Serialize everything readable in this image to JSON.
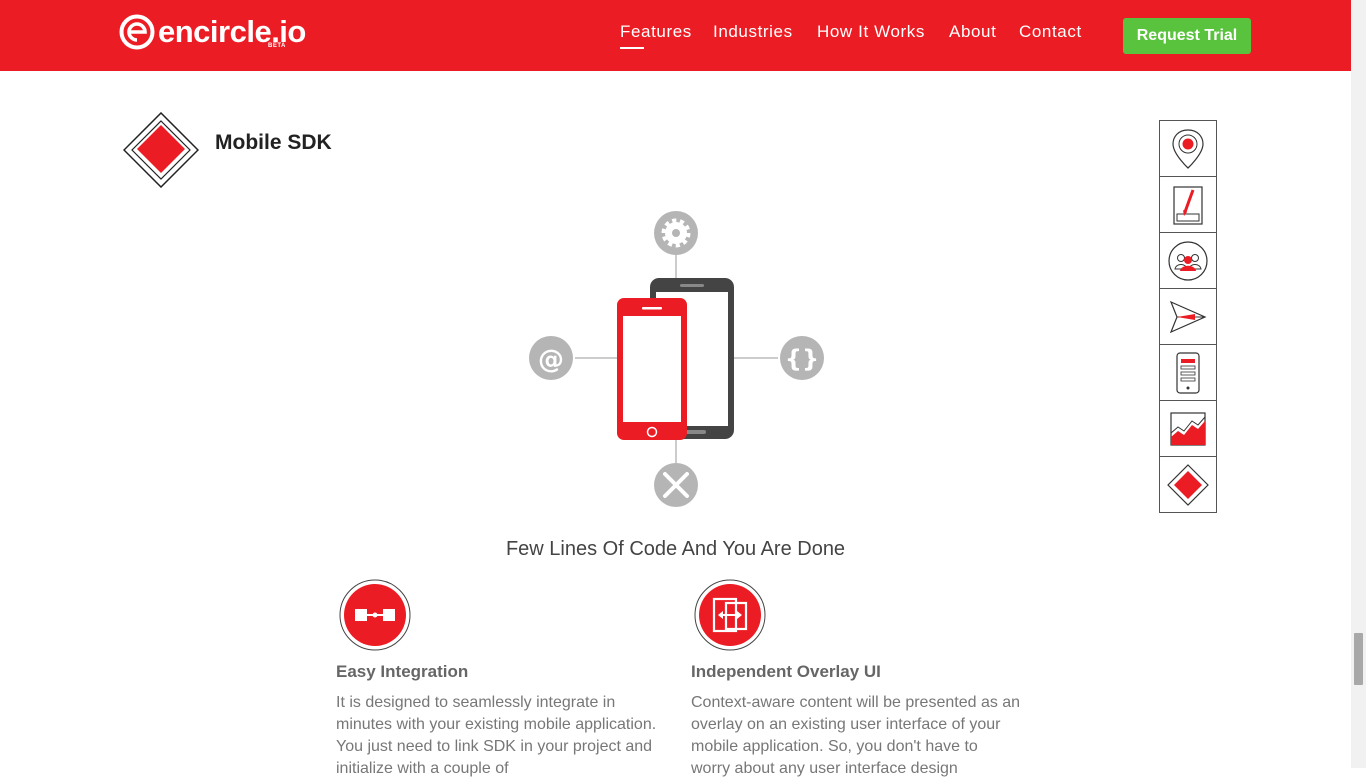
{
  "brand": {
    "name": "encircle.io",
    "badge": "BETA"
  },
  "nav": {
    "items": [
      {
        "label": "Features",
        "active": true
      },
      {
        "label": "Industries",
        "active": false
      },
      {
        "label": "How It Works",
        "active": false
      },
      {
        "label": "About",
        "active": false
      },
      {
        "label": "Contact",
        "active": false
      }
    ],
    "cta_label": "Request Trial"
  },
  "section": {
    "title": "Mobile SDK",
    "icon": "diamond-icon"
  },
  "sidenav": {
    "icons": [
      "map-pin-icon",
      "brush-icon",
      "users-icon",
      "paper-plane-icon",
      "mobile-form-icon",
      "area-chart-icon",
      "diamond-icon"
    ]
  },
  "illustration": {
    "icons": [
      "gear-icon",
      "at-sign-icon",
      "code-braces-icon",
      "tools-icon",
      "phones-icon"
    ]
  },
  "subheading": "Few Lines Of Code And You Are Done",
  "features": [
    {
      "icon": "integration-icon",
      "title": "Easy Integration",
      "body": "It is designed to seamlessly integrate in minutes with your existing mobile application. You just need to link SDK in your project and initialize with a couple of"
    },
    {
      "icon": "overlay-icon",
      "title": "Independent Overlay UI",
      "body": "Context-aware content will be presented as an overlay on an existing user interface of your mobile application. So, you don't have to worry about any user interface design"
    }
  ],
  "colors": {
    "brand_red": "#ec1c24",
    "cta_green": "#5ac33e",
    "icon_gray": "#b5b5b5",
    "phone_dark": "#444444"
  }
}
